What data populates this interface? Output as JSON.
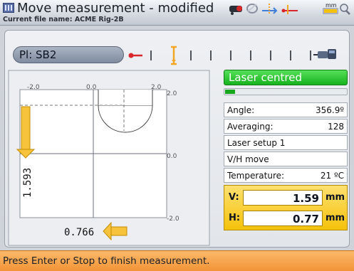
{
  "title": "Move measurement - modified",
  "subtitle": "Current file name: ACME Rig-2B",
  "title_icons": [
    "machine-icon",
    "laser-icon",
    "move-arrows-icon",
    "coupling-icon",
    "unit-mm-icon",
    "search-icon"
  ],
  "unit_icon_text": "mm",
  "plane": {
    "label": "Pl: SB2"
  },
  "strip": {
    "icons": [
      "left-arrow-marker-icon",
      "position-marker-icon",
      "machine-icon"
    ],
    "ticks": 9
  },
  "plot": {
    "x_ticks": [
      "-2.0",
      "0.0",
      "2.0"
    ],
    "y_ticks": [
      "2.0",
      "0.0",
      "-2.0"
    ],
    "vertical_value": "1.593",
    "horizontal_value": "0.766"
  },
  "status": {
    "text": "Laser centred",
    "color": "#1fb526",
    "progress": 0.08
  },
  "fields": {
    "angle_label": "Angle:",
    "angle_value": "356.9º",
    "averaging_label": "Averaging:",
    "averaging_value": "128",
    "laser_setup": "Laser setup 1",
    "vh_move": "V/H move",
    "temperature_label": "Temperature:",
    "temperature_value": "21 ºC"
  },
  "readouts": {
    "v_label": "V:",
    "v_value": "1.59",
    "v_unit": "mm",
    "h_label": "H:",
    "h_value": "0.77",
    "h_unit": "mm"
  },
  "footer": {
    "text": "Press Enter or Stop to finish measurement."
  },
  "colors": {
    "accent_yellow": "#f4c20c",
    "status_green": "#1fb526",
    "footer_orange": "#f39436",
    "marker_red": "#d8262a"
  }
}
